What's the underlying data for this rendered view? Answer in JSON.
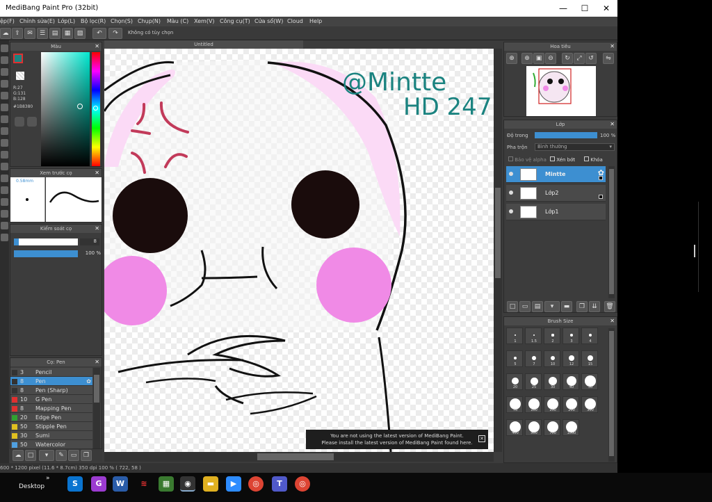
{
  "app": {
    "title": "MediBang Paint Pro (32bit)",
    "canvas_tab": "Untitled"
  },
  "menu": [
    "ệp(F)",
    "Chỉnh sửa(E)",
    "Lớp(L)",
    "Bộ lọc(R)",
    "Chọn(S)",
    "Chụp(N)",
    "Màu (C)",
    "Xem(V)",
    "Công cụ(T)",
    "Cửa sổ(W)",
    "Cloud",
    "Help"
  ],
  "toolbar": {
    "no_option": "Không có tùy chọn"
  },
  "color_panel": {
    "title": "Màu",
    "r": "R:27",
    "g": "G:131",
    "b": "B:128",
    "hex": "#1B8380"
  },
  "preview_panel": {
    "title": "Xem trước cọ",
    "size": "0.58mm"
  },
  "brush_control": {
    "title": "Kiểm soát cọ",
    "size_value": "8",
    "opacity_value": "100 %",
    "size_level": 0.08,
    "opacity_level": 1.0
  },
  "brush_panel": {
    "title": "Cọ: Pen",
    "items": [
      {
        "size": "3",
        "name": "Pencil",
        "color": "#333333"
      },
      {
        "size": "8",
        "name": "Pen",
        "color": "#333333",
        "selected": true
      },
      {
        "size": "8",
        "name": "Pen (Sharp)",
        "color": "#333333"
      },
      {
        "size": "10",
        "name": "G Pen",
        "color": "#e03030"
      },
      {
        "size": "8",
        "name": "Mapping Pen",
        "color": "#e03030"
      },
      {
        "size": "20",
        "name": "Edge Pen",
        "color": "#30a030"
      },
      {
        "size": "50",
        "name": "Stipple Pen",
        "color": "#e0c020"
      },
      {
        "size": "30",
        "name": "Sumi",
        "color": "#e0c020"
      },
      {
        "size": "50",
        "name": "Watercolor",
        "color": "#50a0e0"
      }
    ]
  },
  "navigator": {
    "title": "Hoa tiêu"
  },
  "layer_panel": {
    "title": "Lớp",
    "opacity_label": "Độ trong",
    "opacity_value": "100 %",
    "opacity_level": 1.0,
    "blend_label": "Pha trộn",
    "blend_value": "Bình thường",
    "protect_alpha": "Bảo vệ alpha",
    "clip": "Xén bớt",
    "lock": "Khóa",
    "layers": [
      {
        "name": "Mintte",
        "selected": true
      },
      {
        "name": "Lớp2"
      },
      {
        "name": "Lớp1"
      }
    ]
  },
  "brush_size": {
    "title": "Brush Size",
    "sizes": [
      "1",
      "1.5",
      "2",
      "3",
      "4",
      "5",
      "7",
      "10",
      "12",
      "15",
      "20",
      "25",
      "30",
      "40",
      "50",
      "70",
      "100",
      "150",
      "200",
      "300",
      "400",
      "500",
      "700",
      "1000"
    ]
  },
  "canvas": {
    "signature_line1": "@Mintte",
    "signature_line2": "HD 247"
  },
  "notification": {
    "line1": "You are not using the latest version of MediBang Paint.",
    "line2": "Please install the latest version of MediBang Paint found here."
  },
  "status": {
    "text": "600 * 1200 pixel   (11.6 * 8.7cm)   350 dpi   100 %   ( 722, 58 )"
  },
  "taskbar": {
    "desktop": "Desktop"
  },
  "colors": {
    "accent": "#3d8fd1",
    "pink": "#f08ae6",
    "dark": "#1a0c0c"
  }
}
